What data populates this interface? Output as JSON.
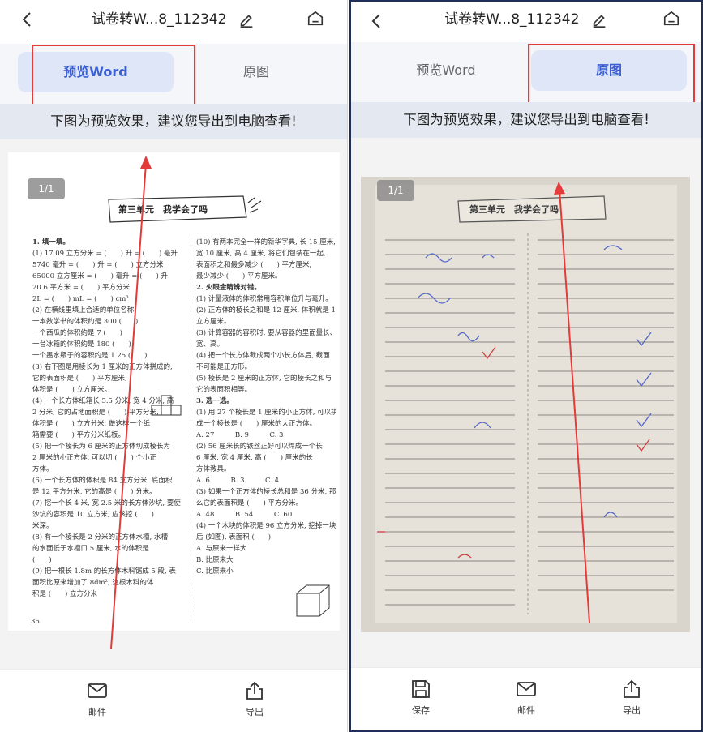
{
  "left": {
    "title": "试卷转W...8_112342",
    "tabs": [
      {
        "label": "预览Word",
        "active": true
      },
      {
        "label": "原图",
        "active": false
      }
    ],
    "notice": "下图为预览效果，建议您导出到电脑查看!",
    "page_indicator": "1/1",
    "doc": {
      "banner": "第三单元　我学会了吗",
      "left_col": [
        "1. 填一填。",
        "(1) 17.09 立方分米 = (　　) 升 = (　　) 毫升",
        "5740 毫升 = (　　) 升 = (　　) 立方分米",
        "65000 立方厘米 = (　　) 毫升 = (　　) 升",
        "20.6 平方米 = (　　) 平方分米",
        "2L = (　　) mL = (　　) cm³",
        "(2) 在横线里填上合适的单位名称",
        "一本数学书的体积约是 300 (　　)",
        "一个西瓜的体积约是 7 (　　)",
        "一台冰箱的体积约是 180 (　　)",
        "一个墨水瓶子的容积约是 1.25 (　　)",
        "(3) 右下图是用棱长为 1 厘米的正方体拼成的,",
        "它的表面积是 (　　) 平方厘米,",
        "体积是 (　　) 立方厘米。",
        "(4) 一个长方体纸箱长 5.5 分米, 宽 4 分米, 高",
        "2 分米, 它的占地面积是 (　　) 平方分米,",
        "体积是 (　　) 立方分米, 做这样一个纸",
        "箱需要 (　　) 平方分米纸板。",
        "(5) 把一个棱长为 6 厘米的正方体切成棱长为",
        "2 厘米的小正方体, 可以切 (　　) 个小正",
        "方体。",
        "(6) 一个长方体的体积是 84 立方分米, 底面积",
        "是 12 平方分米, 它的高是 (　　) 分米。",
        "(7) 挖一个长 4 米, 宽 2.5 米的长方体沙坑, 要使",
        "沙坑的容积是 10 立方米, 应该挖 (　　)",
        "米深。",
        "(8) 有一个棱长是 2 分米的正方体水槽, 水槽",
        "的水面低于水槽口 5 厘米, 水的体积是",
        "(　　)",
        "(9) 把一根长 1.8m 的长方体木料锯成 5 段, 表",
        "面积比原来增加了 8dm², 这根木料的体",
        "积是 (　　) 立方分米"
      ],
      "right_col": [
        "(10) 有两本完全一样的新华字典, 长 15 厘米,",
        "宽 10 厘米, 高 4 厘米, 将它们包装在一起,",
        "表面积之和最多减少 (　　) 平方厘米,",
        "最少减少 (　　) 平方厘米。",
        "2. 火眼金睛辨对错。",
        "(1) 计量液体的体积常用容积单位升与毫升。",
        "(2) 正方体的棱长之和是 12 厘米, 体积就是 1",
        "立方厘米。",
        "(3) 计算容器的容积时, 要从容器的里面量长、",
        "宽、高。",
        "(4) 把一个长方体截成两个小长方体后, 截面",
        "不可能是正方形。",
        "(5) 棱长是 2 厘米的正方体, 它的棱长之和与",
        "它的表面积相等。",
        "3. 选一选。",
        "(1) 用 27 个棱长是 1 厘米的小正方体, 可以拼",
        "成一个棱长是 (　　) 厘米的大正方体。",
        "A. 27　　　B. 9　　　C. 3",
        "(2) 56 厘米长的铁丝正好可以焊成一个长",
        "6 厘米, 宽 4 厘米, 高 (　　) 厘米的长",
        "方体教具。",
        "A. 6　　　B. 3　　　C. 4",
        "(3) 如果一个正方体的棱长总和是 36 分米, 那",
        "么它的表面积是 (　　) 平方分米。",
        "A. 48　　　B. 54　　　C. 60",
        "(4) 一个木块的体积是 96 立方分米, 挖掉一块",
        "后 (如图), 表面积 (　　)",
        "A. 与原来一样大",
        "B. 比原来大",
        "C. 比原来小"
      ],
      "page_no": "36"
    },
    "actions": [
      {
        "label": "邮件",
        "icon": "mail-icon"
      },
      {
        "label": "导出",
        "icon": "export-icon"
      }
    ]
  },
  "right": {
    "title": "试卷转W...8_112342",
    "tabs": [
      {
        "label": "预览Word",
        "active": false
      },
      {
        "label": "原图",
        "active": true
      }
    ],
    "notice": "下图为预览效果，建议您导出到电脑查看!",
    "page_indicator": "1/1",
    "photo_banner": "第三单元　我学会了吗",
    "actions": [
      {
        "label": "保存",
        "icon": "save-icon"
      },
      {
        "label": "邮件",
        "icon": "mail-icon"
      },
      {
        "label": "导出",
        "icon": "export-icon"
      }
    ]
  },
  "colors": {
    "active_tab_bg": "#dfe6f8",
    "active_tab_text": "#3a5fd0",
    "annotation_red": "#e33a3a",
    "notice_bg": "#e3e8f1"
  }
}
